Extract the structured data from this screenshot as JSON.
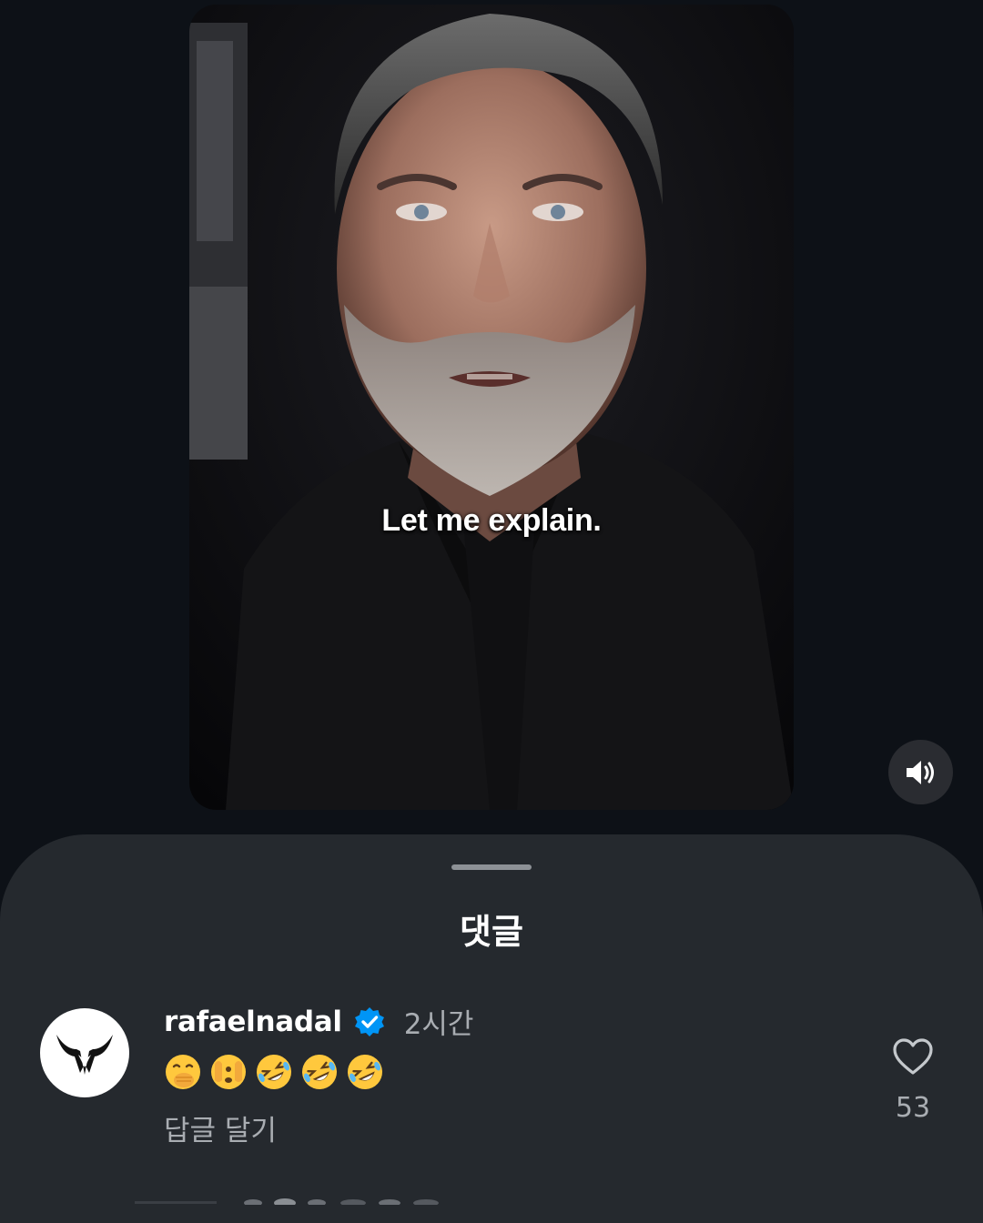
{
  "video": {
    "caption": "Let me explain."
  },
  "comments_sheet": {
    "title": "댓글",
    "comment": {
      "username": "rafaelnadal",
      "time": "2시간",
      "emojis": [
        "hand-over-mouth",
        "face-with-peeking-eye",
        "rolling-on-the-floor-laughing",
        "rolling-on-the-floor-laughing",
        "rolling-on-the-floor-laughing"
      ],
      "reply_label": "답글 달기",
      "like_count": "53"
    }
  },
  "icons": {
    "sound": "speaker-on-icon",
    "verified": "verified-badge-icon",
    "like": "heart-outline-icon",
    "avatar_logo": "rafa-bull-logo"
  },
  "colors": {
    "background": "#0d1117",
    "sheet": "#25292e",
    "verified_blue": "#0095f6",
    "muted_text": "#a9adb2"
  }
}
